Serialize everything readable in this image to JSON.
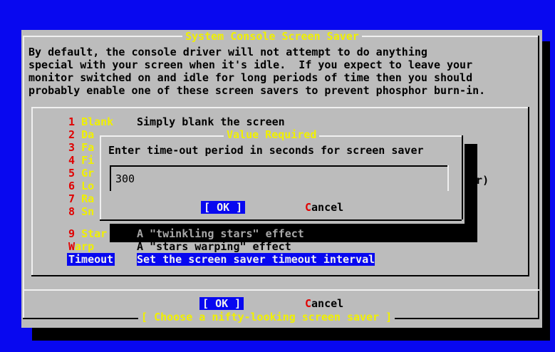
{
  "main_dialog": {
    "title": "System Console Screen Saver",
    "description": [
      "By default, the console driver will not attempt to do anything",
      "special with your screen when it's idle.  If you expect to leave your",
      "monitor switched on and idle for long periods of time then you should",
      "probably enable one of these screen savers to prevent phosphor burn-in."
    ],
    "items": [
      {
        "key": "1",
        "tag": "Blank",
        "desc": "Simply blank the screen"
      },
      {
        "key": "2",
        "tag": "Da",
        "desc": ""
      },
      {
        "key": "3",
        "tag": "Fa",
        "desc": ""
      },
      {
        "key": "4",
        "tag": "Fi",
        "desc": ""
      },
      {
        "key": "5",
        "tag": "Gr",
        "desc": "tor)"
      },
      {
        "key": "6",
        "tag": "Lo",
        "desc": ""
      },
      {
        "key": "7",
        "tag": "Ra",
        "desc": ""
      },
      {
        "key": "8",
        "tag": "Sn",
        "desc": ""
      },
      {
        "key": "9",
        "tag": "Star",
        "desc": "A \"twinkling stars\" effect"
      },
      {
        "key": "W",
        "tag": "arp",
        "desc": "A \"stars warping\" effect"
      },
      {
        "key": "",
        "tag": "Timeout",
        "desc": "Set the screen saver timeout interval"
      }
    ],
    "ok_label": "OK",
    "cancel_label": "ancel",
    "cancel_hot": "C",
    "footer": "Choose a nifty-looking screen saver"
  },
  "value_dialog": {
    "title": "Value Required",
    "prompt": "Enter time-out period in seconds for screen saver",
    "input_value": "300",
    "ok_label": "OK",
    "cancel_label": "ancel",
    "cancel_hot": "C"
  },
  "colors": {
    "background": "#0808f0",
    "dialog": "#bcbcbc",
    "title": "#f0f000",
    "hotkey": "#e00000",
    "highlight": "#0808f0"
  }
}
